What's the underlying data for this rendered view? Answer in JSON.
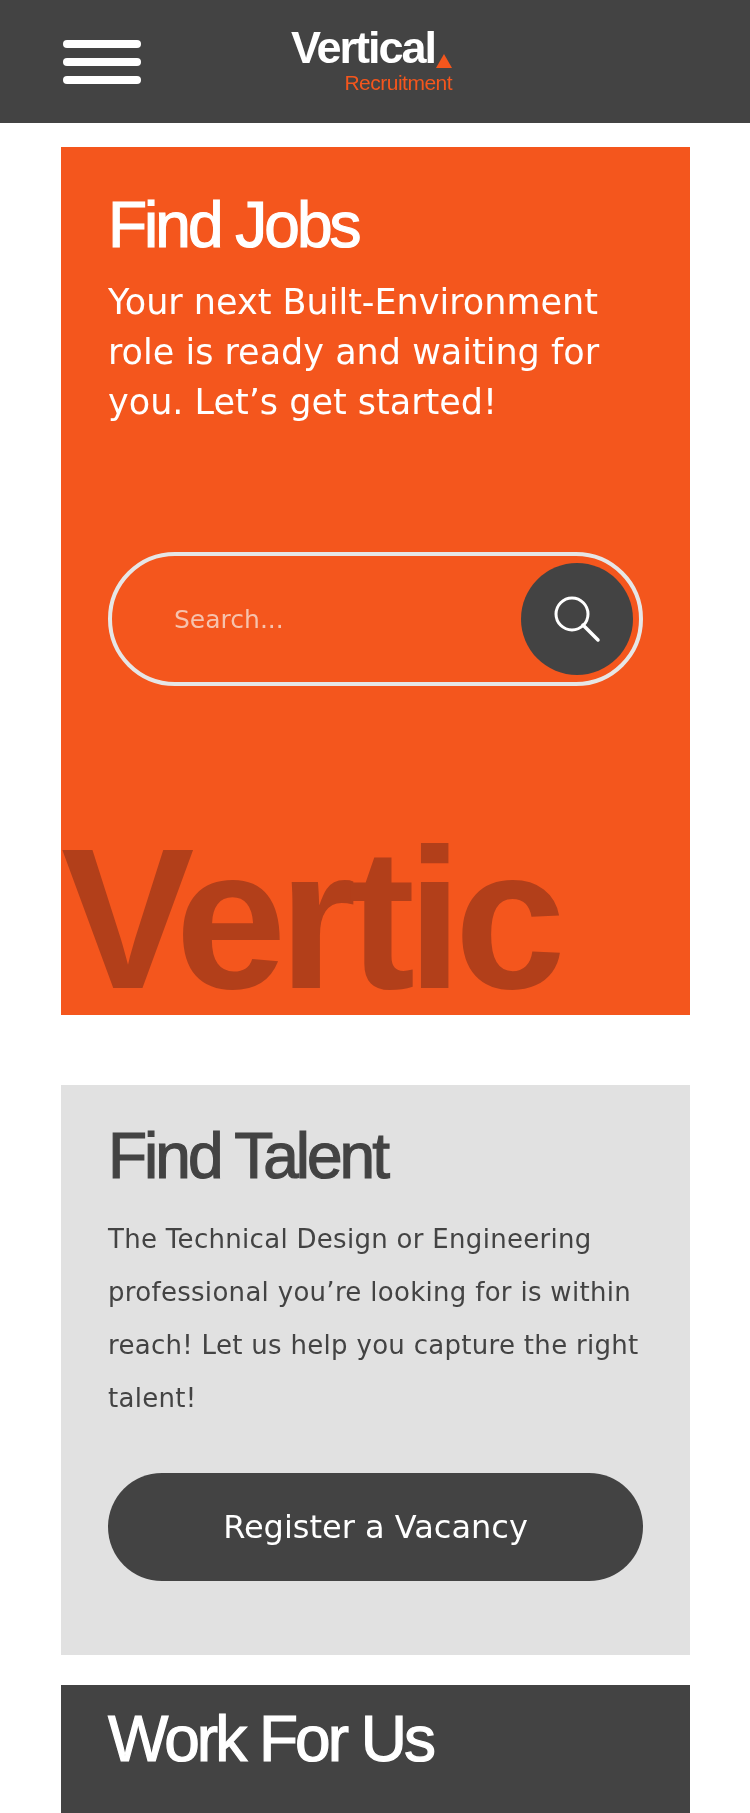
{
  "header": {
    "logo": {
      "name": "Vertical",
      "tagline": "Recruitment"
    }
  },
  "find_jobs": {
    "title": "Find Jobs",
    "text": "Your next Built-Environment role is ready and waiting for you. Let’s get started!",
    "search": {
      "placeholder": "Search..."
    },
    "background_word": "Vertic"
  },
  "find_talent": {
    "title": "Find Talent",
    "text": "The Technical Design or Engineering professional you’re looking for is within reach! Let us help you capture the right talent!",
    "button": "Register a Vacancy"
  },
  "work_for_us": {
    "title": "Work For Us"
  }
}
